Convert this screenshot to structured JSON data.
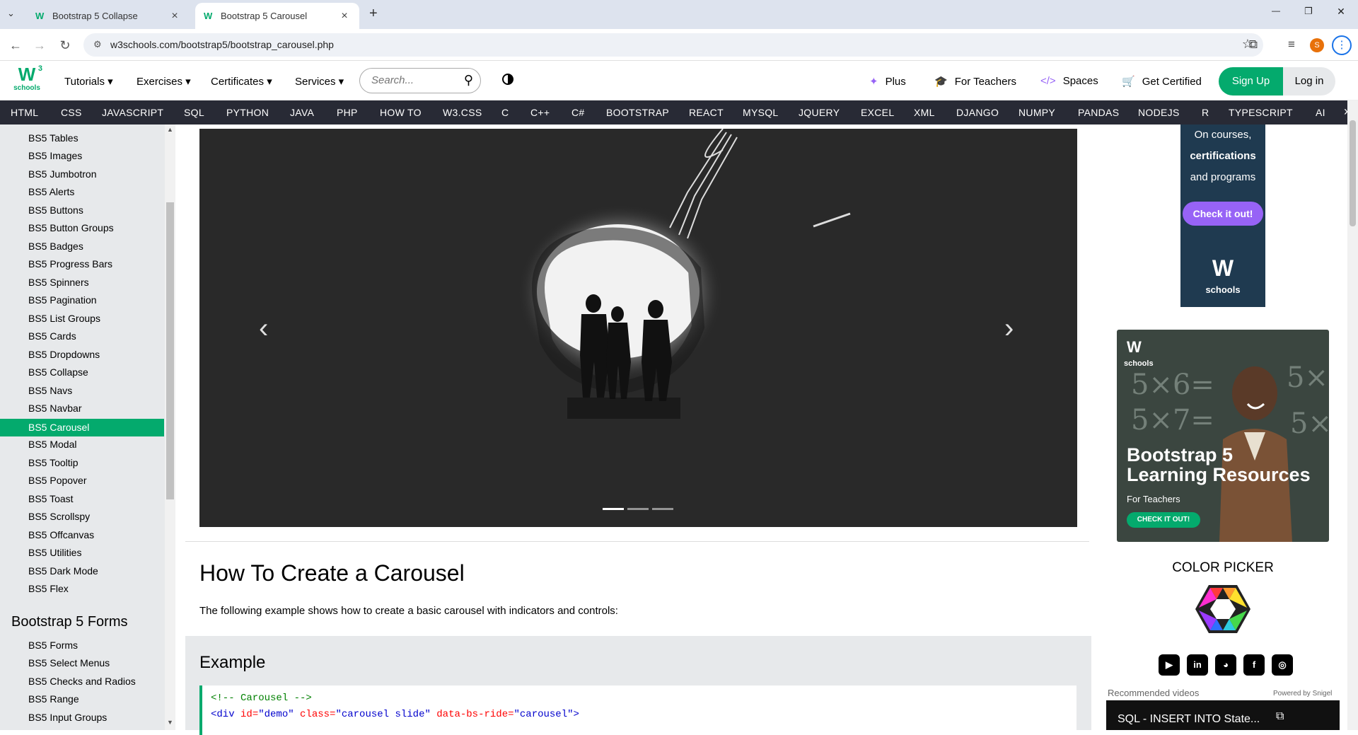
{
  "browser": {
    "tabs": [
      {
        "favicon": "W",
        "title": "Bootstrap 5 Collapse"
      },
      {
        "favicon": "W",
        "title": "Bootstrap 5 Carousel"
      }
    ],
    "new_tab": "+",
    "url": "w3schools.com/bootstrap5/bootstrap_carousel.php",
    "profile_initial": "S",
    "window": {
      "minimize": "—",
      "restore": "❐",
      "close": "✕"
    }
  },
  "topnav": {
    "logo_letter": "W",
    "logo_sup": "3",
    "logo_text": "schools",
    "menus": [
      "Tutorials ▾",
      "Exercises ▾",
      "Certificates ▾",
      "Services ▾"
    ],
    "search_placeholder": "Search...",
    "right_links": [
      {
        "icon": "sparkle-icon",
        "glyph": "✦",
        "label": "Plus"
      },
      {
        "icon": "graduation-cap-icon",
        "glyph": "🎓",
        "label": "For Teachers"
      },
      {
        "icon": "code-icon",
        "glyph": "</>",
        "label": "Spaces"
      },
      {
        "icon": "cart-icon",
        "glyph": "🛒",
        "label": "Get Certified"
      }
    ],
    "signup": "Sign Up",
    "login": "Log in"
  },
  "subnav": [
    "HTML",
    "CSS",
    "JAVASCRIPT",
    "SQL",
    "PYTHON",
    "JAVA",
    "PHP",
    "HOW TO",
    "W3.CSS",
    "C",
    "C++",
    "C#",
    "BOOTSTRAP",
    "REACT",
    "MYSQL",
    "JQUERY",
    "EXCEL",
    "XML",
    "DJANGO",
    "NUMPY",
    "PANDAS",
    "NODEJS",
    "R",
    "TYPESCRIPT",
    "AI"
  ],
  "sidebar": {
    "items": [
      "BS5 Tables",
      "BS5 Images",
      "BS5 Jumbotron",
      "BS5 Alerts",
      "BS5 Buttons",
      "BS5 Button Groups",
      "BS5 Badges",
      "BS5 Progress Bars",
      "BS5 Spinners",
      "BS5 Pagination",
      "BS5 List Groups",
      "BS5 Cards",
      "BS5 Dropdowns",
      "BS5 Collapse",
      "BS5 Navs",
      "BS5 Navbar",
      "BS5 Carousel",
      "BS5 Modal",
      "BS5 Tooltip",
      "BS5 Popover",
      "BS5 Toast",
      "BS5 Scrollspy",
      "BS5 Offcanvas",
      "BS5 Utilities",
      "BS5 Dark Mode",
      "BS5 Flex"
    ],
    "active": "BS5 Carousel",
    "forms_heading": "Bootstrap 5 Forms",
    "forms_items": [
      "BS5 Forms",
      "BS5 Select Menus",
      "BS5 Checks and Radios",
      "BS5 Range",
      "BS5 Input Groups"
    ]
  },
  "main": {
    "carousel": {
      "prev": "‹",
      "next": "›",
      "indicators": 3,
      "active_index": 0
    },
    "heading": "How To Create a Carousel",
    "intro": "The following example shows how to create a basic carousel with indicators and controls:",
    "example_heading": "Example",
    "code_line1": "<!-- Carousel -->",
    "code_line2": {
      "tag_open": "<div",
      "attr1": " id=",
      "val1": "\"demo\"",
      "attr2": " class=",
      "val2": "\"carousel slide\"",
      "attr3": " data-bs-ride=",
      "val3": "\"carousel\"",
      "tag_close": ">"
    }
  },
  "ads": {
    "ad1_lines": [
      "On courses,",
      "certifications",
      "and programs"
    ],
    "ad1_button": "Check it out!",
    "ad1_logo": "W",
    "ad1_logo_text": "schools",
    "ad2_logo": "W",
    "ad2_logo_text": "schools",
    "ad2_title_1": "Bootstrap 5",
    "ad2_title_2": "Learning Resources",
    "ad2_sub": "For Teachers",
    "ad2_button": "CHECK IT OUT!",
    "ad2_chalk": [
      "5×6=",
      "5×7=",
      "5×",
      "5×"
    ]
  },
  "color_picker_title": "COLOR PICKER",
  "social": [
    {
      "icon": "youtube-icon",
      "glyph": "▶"
    },
    {
      "icon": "linkedin-icon",
      "glyph": "in"
    },
    {
      "icon": "discord-icon",
      "glyph": "◕"
    },
    {
      "icon": "facebook-icon",
      "glyph": "f"
    },
    {
      "icon": "instagram-icon",
      "glyph": "◎"
    }
  ],
  "recommended": {
    "label": "Recommended videos",
    "powered": "Powered by Snigel",
    "video_title": "SQL - INSERT INTO State...",
    "video_ext": "⧉"
  },
  "colors": {
    "brand": "#04aa6d",
    "dark_nav": "#282a35",
    "accent": "#9763f6"
  }
}
